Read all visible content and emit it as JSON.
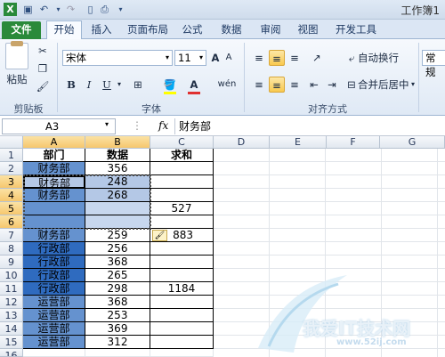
{
  "app": {
    "title": "工作簿1"
  },
  "tabs": [
    {
      "label": "文件"
    },
    {
      "label": "开始"
    },
    {
      "label": "插入"
    },
    {
      "label": "页面布局"
    },
    {
      "label": "公式"
    },
    {
      "label": "数据"
    },
    {
      "label": "审阅"
    },
    {
      "label": "视图"
    },
    {
      "label": "开发工具"
    }
  ],
  "ribbon": {
    "clipboard": {
      "paste": "粘贴",
      "label": "剪贴板"
    },
    "font": {
      "name": "宋体",
      "size": "11",
      "bold": "B",
      "italic": "I",
      "underline": "U",
      "fontcolor": "A",
      "label": "字体"
    },
    "align": {
      "wrap": "自动换行",
      "merge": "合并后居中",
      "label": "对齐方式"
    },
    "number": {
      "format": "常规"
    }
  },
  "formula": {
    "namebox": "A3",
    "fx": "fx",
    "value": "财务部"
  },
  "columns": [
    "A",
    "B",
    "C",
    "D",
    "E",
    "F",
    "G"
  ],
  "rows": [
    "1",
    "2",
    "3",
    "4",
    "5",
    "6",
    "7",
    "8",
    "9",
    "10",
    "11",
    "12",
    "13",
    "14",
    "15",
    "16"
  ],
  "table": {
    "headers": [
      "部门",
      "数据",
      "求和"
    ],
    "cells": [
      {
        "a": "财务部",
        "b": "356",
        "c": ""
      },
      {
        "a": "财务部",
        "b": "248",
        "c": ""
      },
      {
        "a": "财务部",
        "b": "268",
        "c": ""
      },
      {
        "a": "",
        "b": "",
        "c": "527"
      },
      {
        "a": "",
        "b": "",
        "c": ""
      },
      {
        "a": "财务部",
        "b": "259",
        "c": "883"
      },
      {
        "a": "行政部",
        "b": "256",
        "c": ""
      },
      {
        "a": "行政部",
        "b": "368",
        "c": ""
      },
      {
        "a": "行政部",
        "b": "265",
        "c": ""
      },
      {
        "a": "行政部",
        "b": "298",
        "c": "1184"
      },
      {
        "a": "运营部",
        "b": "368",
        "c": ""
      },
      {
        "a": "运营部",
        "b": "253",
        "c": ""
      },
      {
        "a": "运营部",
        "b": "369",
        "c": ""
      },
      {
        "a": "运营部",
        "b": "312",
        "c": ""
      }
    ]
  },
  "watermark": {
    "text": "我爱IT技术网",
    "url": "www.52ij.com"
  },
  "colors": {
    "accent": "#2a8a3a",
    "selection": "#f6c76e",
    "rowShade": "#2f6bbf"
  }
}
